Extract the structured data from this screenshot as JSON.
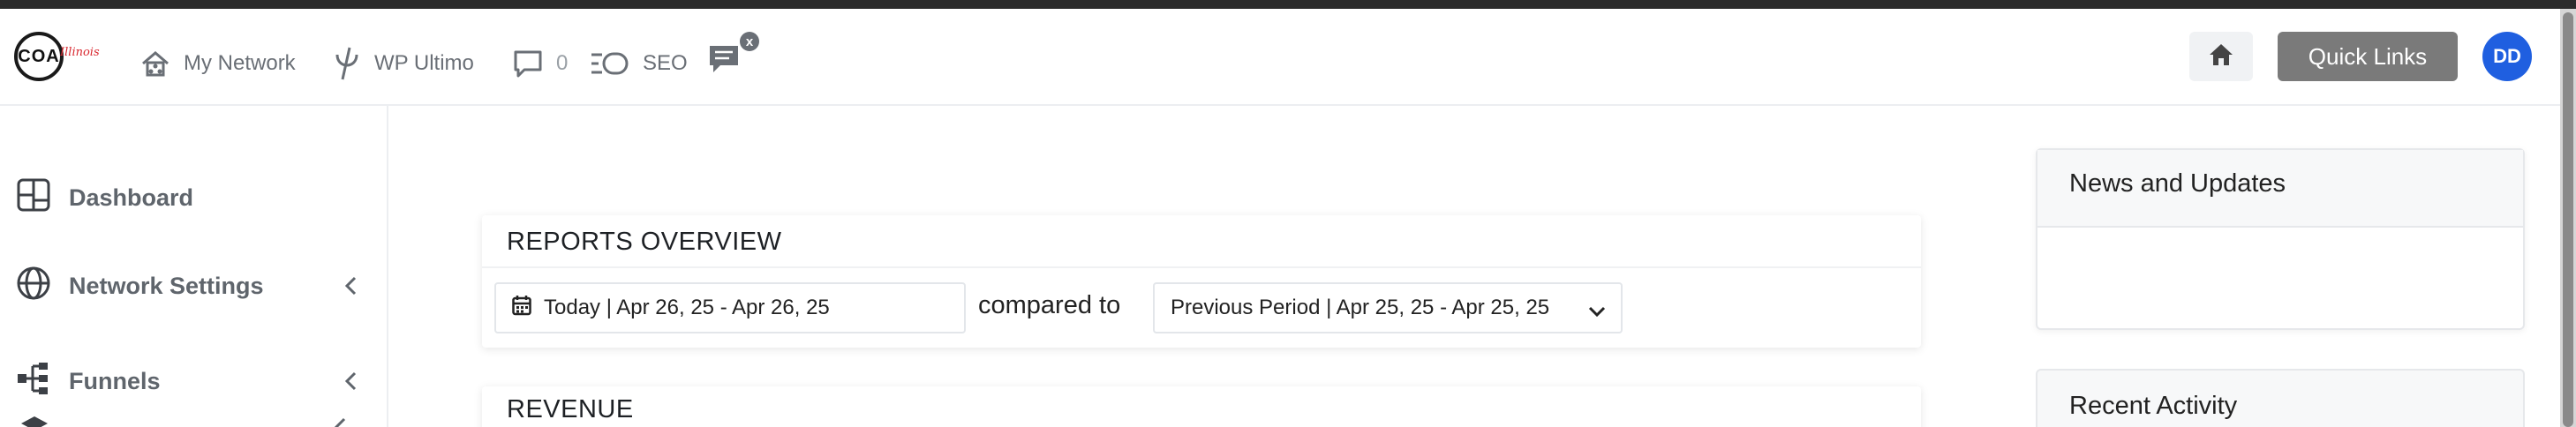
{
  "brand": {
    "logo_text": "COA",
    "logo_script": "Illinois"
  },
  "header": {
    "nav": [
      {
        "label": "My Network",
        "icon": "network-house-icon"
      },
      {
        "label": "WP Ultimo",
        "icon": "wp-ultimo-icon"
      },
      {
        "label": "0",
        "icon": "comment-icon"
      },
      {
        "label": "SEO",
        "icon": "seo-icon"
      }
    ],
    "notification_badge": "x",
    "quick_links_label": "Quick Links",
    "avatar_initials": "DD"
  },
  "sidebar": {
    "items": [
      {
        "label": "Dashboard",
        "icon": "dashboard-icon",
        "has_chevron": false
      },
      {
        "label": "Network Settings",
        "icon": "globe-icon",
        "has_chevron": true
      },
      {
        "label": "Funnels",
        "icon": "funnels-icon",
        "has_chevron": true
      }
    ]
  },
  "reports": {
    "title": "REPORTS OVERVIEW",
    "date_range": "Today | Apr 26, 25 - Apr 26, 25",
    "compared_to_label": "compared to",
    "compare_range": "Previous Period | Apr 25, 25 - Apr 25, 25"
  },
  "revenue": {
    "title": "REVENUE"
  },
  "right_panel": {
    "news_title": "News and Updates",
    "activity_title": "Recent Activity"
  },
  "colors": {
    "quick_links_bg": "#7a7a7a",
    "avatar_bg": "#1f5fe0",
    "logo_script": "#d9282f"
  }
}
